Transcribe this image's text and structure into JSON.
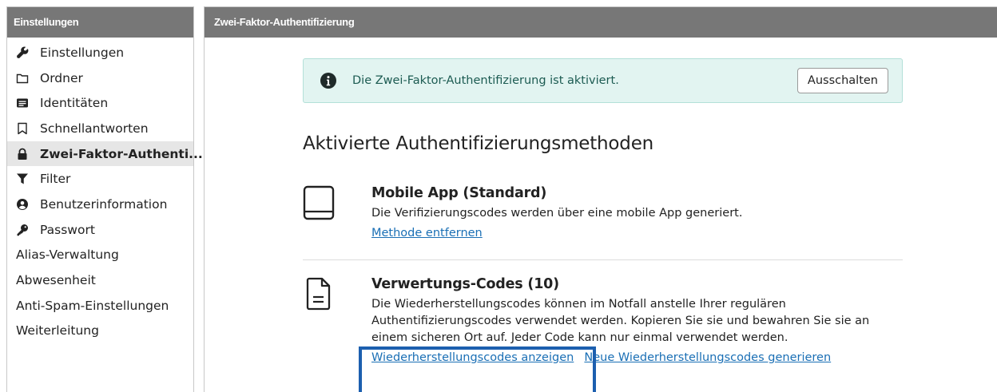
{
  "sidebar": {
    "title": "Einstellungen",
    "items": [
      {
        "label": "Einstellungen",
        "icon": "wrench-icon"
      },
      {
        "label": "Ordner",
        "icon": "folder-icon"
      },
      {
        "label": "Identitäten",
        "icon": "id-card-icon"
      },
      {
        "label": "Schnellantworten",
        "icon": "bookmark-icon"
      },
      {
        "label": "Zwei-Faktor-Authenti...",
        "icon": "lock-icon",
        "active": true
      },
      {
        "label": "Filter",
        "icon": "filter-icon"
      },
      {
        "label": "Benutzerinformation",
        "icon": "user-circle-icon"
      },
      {
        "label": "Passwort",
        "icon": "key-icon"
      },
      {
        "label": "Alias-Verwaltung"
      },
      {
        "label": "Abwesenheit"
      },
      {
        "label": "Anti-Spam-Einstellungen"
      },
      {
        "label": "Weiterleitung"
      }
    ]
  },
  "main": {
    "title": "Zwei-Faktor-Authentifizierung",
    "alert": {
      "text": "Die Zwei-Faktor-Authentifizierung ist aktiviert.",
      "button": "Ausschalten"
    },
    "section_title": "Aktivierte Authentifizierungsmethoden",
    "methods": [
      {
        "title": "Mobile App (Standard)",
        "description": "Die Verifizierungscodes werden über eine mobile App generiert.",
        "links": [
          "Methode entfernen"
        ]
      },
      {
        "title": "Verwertungs-Codes (10)",
        "description": "Die Wiederherstellungscodes können im Notfall anstelle Ihrer regulären Authentifizierungscodes verwendet werden. Kopieren Sie sie und bewahren Sie sie an einem sicheren Ort auf. Jeder Code kann nur einmal verwendet werden.",
        "links": [
          "Wiederherstellungscodes anzeigen",
          "Neue Wiederherstellungscodes generieren"
        ]
      }
    ]
  },
  "colors": {
    "header_bg": "#777777",
    "alert_bg": "#e2f4f1",
    "alert_text": "#1c5b52",
    "link": "#1a6fb5",
    "highlight": "#1c5faf"
  }
}
